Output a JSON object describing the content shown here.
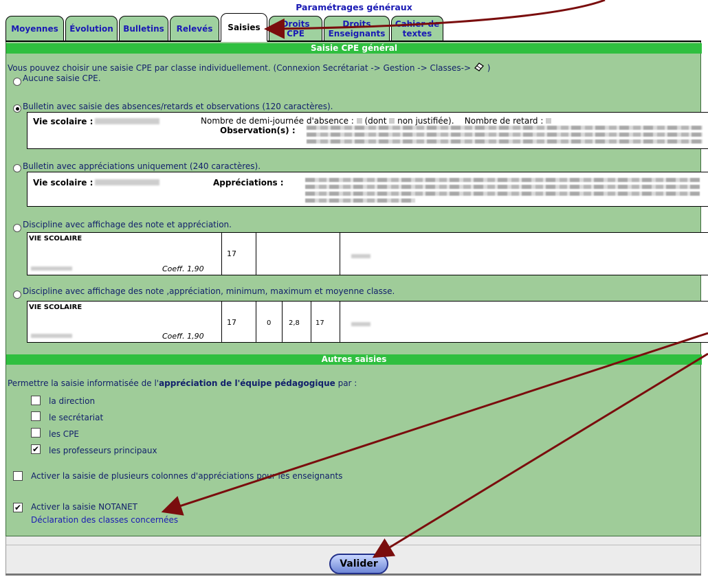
{
  "page_title": "Paramétrages généraux",
  "tabs": [
    {
      "label": "Moyennes"
    },
    {
      "label": "Évolution"
    },
    {
      "label": "Bulletins"
    },
    {
      "label": "Relevés"
    },
    {
      "label": "Saisies",
      "active": true
    },
    {
      "label_line1": "Droits",
      "label_line2": "CPE"
    },
    {
      "label_line1": "Droits",
      "label_line2": "Enseignants"
    },
    {
      "label_line1": "Cahier de",
      "label_line2": "textes"
    }
  ],
  "section_cpe": {
    "title": "Saisie CPE général",
    "intro": "Vous pouvez choisir une saisie CPE par classe individuellement.  (Connexion Secrétariat -> Gestion -> Classes->",
    "intro_end": ")",
    "options": [
      {
        "label": "Aucune saisie CPE.",
        "selected": false
      },
      {
        "label": "Bulletin avec saisie des absences/retards et observations (120 caractères).",
        "selected": true
      },
      {
        "label": "Bulletin avec appréciations uniquement (240 caractères).",
        "selected": false
      },
      {
        "label": "Discipline avec affichage des note et appréciation.",
        "selected": false
      },
      {
        "label": "Discipline avec affichage des  note ,appréciation, minimum, maximum et moyenne classe.",
        "selected": false
      }
    ],
    "preview1": {
      "vie_scolaire_label": "Vie scolaire :",
      "absence_text": "Nombre de demi-journée d'absence :",
      "dont_text": "(dont",
      "non_justifiee_text": "non justifiée).",
      "retard_text": "Nombre de retard :",
      "observation_label": "Observation(s) :"
    },
    "preview2": {
      "vie_scolaire_label": "Vie scolaire :",
      "appreciations_label": "Appréciations :"
    },
    "preview3": {
      "subject": "VIE SCOLAIRE",
      "coeff": "Coeff. 1,90",
      "note": "17"
    },
    "preview4": {
      "subject": "VIE SCOLAIRE",
      "coeff": "Coeff. 1,90",
      "note": "17",
      "min": "0",
      "moyenne": "2,8",
      "max": "17"
    }
  },
  "section_autres": {
    "title": "Autres saisies",
    "intro_start": "Permettre la saisie informatisée de l'",
    "intro_bold": "appréciation de l'équipe pédagogique",
    "intro_end": " par :",
    "checkboxes": [
      {
        "label": "la direction",
        "checked": false
      },
      {
        "label": "le secrétariat",
        "checked": false
      },
      {
        "label": "les CPE",
        "checked": false
      },
      {
        "label": "les professeurs principaux",
        "checked": true
      }
    ],
    "multi_col": {
      "label": "Activer la saisie de plusieurs colonnes d'appréciations pour les enseignants",
      "checked": false
    },
    "notanet": {
      "label": "Activer la saisie NOTANET",
      "checked": true
    },
    "notanet_link": "Déclaration des classes concernées"
  },
  "submit_label": "Valider",
  "colors": {
    "panel": "#9fcc99",
    "section_bar": "#2fbf3f",
    "tab_text": "#1a1ab4",
    "arrow": "#7a0d0d"
  },
  "icons": [
    "eraser-icon",
    "radio-icon",
    "checkbox-icon",
    "arrow-annotation-icon"
  ]
}
